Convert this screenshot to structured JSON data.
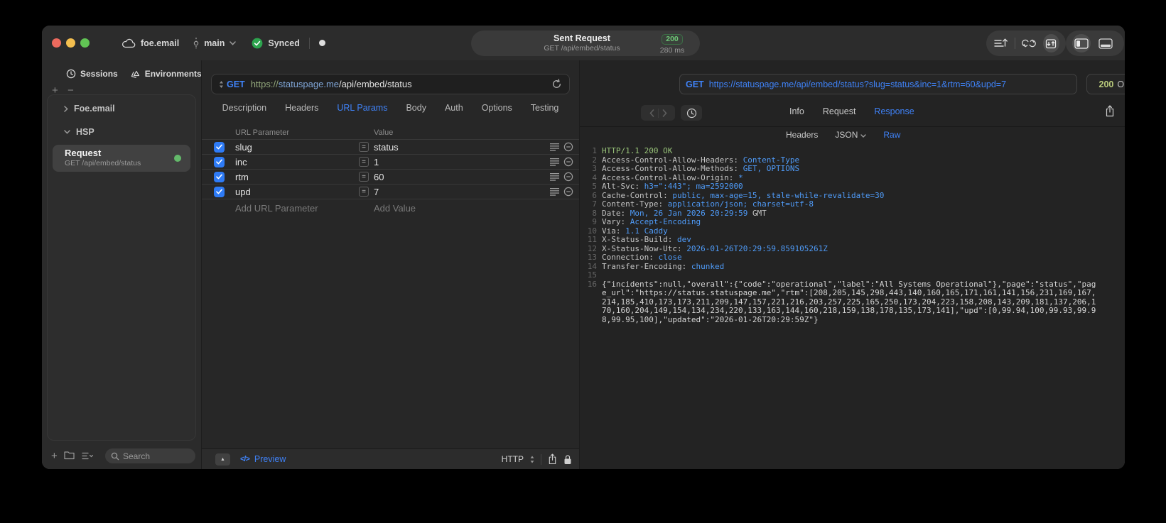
{
  "titlebar": {
    "account": "foe.email",
    "branch": "main",
    "sync": "Synced",
    "request_title": "Sent Request",
    "request_subtitle": "GET /api/embed/status",
    "status_code": "200",
    "duration": "280 ms"
  },
  "sidebar": {
    "tabs": [
      {
        "label": "Sessions"
      },
      {
        "label": "Environments"
      }
    ],
    "tree": {
      "group1": "Foe.email",
      "group2": "HSP"
    },
    "request": {
      "title": "Request",
      "subtitle": "GET /api/embed/status"
    },
    "search_placeholder": "Search"
  },
  "request_panel": {
    "method": "GET",
    "url": {
      "scheme": "https://",
      "host": "statuspage.me",
      "path": "/api/embed/status"
    },
    "tabs": [
      "Description",
      "Headers",
      "URL Params",
      "Body",
      "Auth",
      "Options",
      "Testing"
    ],
    "active_tab": "URL Params",
    "table": {
      "col_param": "URL Parameter",
      "col_value": "Value",
      "rows": [
        {
          "name": "slug",
          "value": "status",
          "enabled": true
        },
        {
          "name": "inc",
          "value": "1",
          "enabled": true
        },
        {
          "name": "rtm",
          "value": "60",
          "enabled": true
        },
        {
          "name": "upd",
          "value": "7",
          "enabled": true
        }
      ],
      "add_param": "Add URL Parameter",
      "add_value": "Add Value"
    },
    "footer": {
      "code_glyph": "</>",
      "preview": "Preview",
      "protocol": "HTTP"
    }
  },
  "response_panel": {
    "method": "GET",
    "url": "https://statuspage.me/api/embed/status?slug=status&inc=1&rtm=60&upd=7",
    "status_code": "200",
    "status_text": "OK",
    "tabs": [
      "Info",
      "Request",
      "Response"
    ],
    "active_tab": "Response",
    "subtabs": [
      {
        "label": "Headers"
      },
      {
        "label": "JSON",
        "dropdown": true
      },
      {
        "label": "Raw"
      }
    ],
    "active_subtab": "Raw",
    "lines": [
      {
        "n": "1",
        "parts": [
          {
            "c": "status",
            "t": "HTTP/1.1 200 OK"
          }
        ]
      },
      {
        "n": "2",
        "parts": [
          {
            "c": "name",
            "t": "Access-Control-Allow-Headers: "
          },
          {
            "c": "val",
            "t": "Content-Type"
          }
        ]
      },
      {
        "n": "3",
        "parts": [
          {
            "c": "name",
            "t": "Access-Control-Allow-Methods: "
          },
          {
            "c": "val",
            "t": "GET, OPTIONS"
          }
        ]
      },
      {
        "n": "4",
        "parts": [
          {
            "c": "name",
            "t": "Access-Control-Allow-Origin: "
          },
          {
            "c": "val",
            "t": "*"
          }
        ]
      },
      {
        "n": "5",
        "parts": [
          {
            "c": "name",
            "t": "Alt-Svc: "
          },
          {
            "c": "val",
            "t": "h3=\":443\"; ma=2592000"
          }
        ]
      },
      {
        "n": "6",
        "parts": [
          {
            "c": "name",
            "t": "Cache-Control: "
          },
          {
            "c": "val",
            "t": "public, max-age=15, stale-while-revalidate=30"
          }
        ]
      },
      {
        "n": "7",
        "parts": [
          {
            "c": "name",
            "t": "Content-Type: "
          },
          {
            "c": "val",
            "t": "application/json; charset=utf-8"
          }
        ]
      },
      {
        "n": "8",
        "parts": [
          {
            "c": "name",
            "t": "Date: "
          },
          {
            "c": "val",
            "t": "Mon, 26 Jan 2026 20:29:59 "
          },
          {
            "c": "name",
            "t": "GMT"
          }
        ]
      },
      {
        "n": "9",
        "parts": [
          {
            "c": "name",
            "t": "Vary: "
          },
          {
            "c": "val",
            "t": "Accept-Encoding"
          }
        ]
      },
      {
        "n": "10",
        "parts": [
          {
            "c": "name",
            "t": "Via: "
          },
          {
            "c": "val",
            "t": "1.1 Caddy"
          }
        ]
      },
      {
        "n": "11",
        "parts": [
          {
            "c": "name",
            "t": "X-Status-Build: "
          },
          {
            "c": "val",
            "t": "dev"
          }
        ]
      },
      {
        "n": "12",
        "parts": [
          {
            "c": "name",
            "t": "X-Status-Now-Utc: "
          },
          {
            "c": "val",
            "t": "2026-01-26T20:29:59.859105261Z"
          }
        ]
      },
      {
        "n": "13",
        "parts": [
          {
            "c": "name",
            "t": "Connection: "
          },
          {
            "c": "val",
            "t": "close"
          }
        ]
      },
      {
        "n": "14",
        "parts": [
          {
            "c": "name",
            "t": "Transfer-Encoding: "
          },
          {
            "c": "val",
            "t": "chunked"
          }
        ]
      },
      {
        "n": "15",
        "parts": []
      },
      {
        "n": "16",
        "parts": [
          {
            "c": "body",
            "t": "{\"incidents\":null,\"overall\":{\"code\":\"operational\",\"label\":\"All Systems Operational\"},\"page\":\"status\",\"page_url\":\"https://status.statuspage.me\",\"rtm\":[208,205,145,298,443,140,160,165,171,161,141,156,231,169,167,214,185,410,173,173,211,209,147,157,221,216,203,257,225,165,250,173,204,223,158,208,143,209,181,137,206,170,160,204,149,154,134,234,220,133,163,144,160,218,159,138,178,135,173,141],\"upd\":[0,99.94,100,99.93,99.98,99.95,100],\"updated\":\"2026-01-26T20:29:59Z\"}"
          }
        ]
      }
    ]
  },
  "colors": {
    "accent_blue": "#3f82f7",
    "titlebar_status_green": "#6ec877",
    "header_value_blue": "#4f9bf8",
    "status_line_green": "#98c379",
    "response_code_olive": "#b8c97a",
    "checkbox_blue": "#2e7bf6",
    "request_dot_green": "#63b96a",
    "traffic_red": "#ec6a5e",
    "traffic_yellow": "#f4bf4f",
    "traffic_green": "#61c454"
  }
}
